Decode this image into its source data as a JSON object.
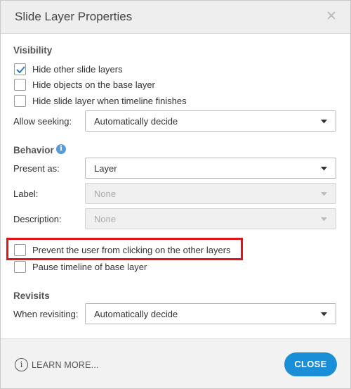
{
  "dialog": {
    "title": "Slide Layer Properties",
    "close_icon": "close-x-icon"
  },
  "visibility": {
    "heading": "Visibility",
    "options": [
      {
        "label": "Hide other slide layers",
        "checked": true
      },
      {
        "label": "Hide objects on the base layer",
        "checked": false
      },
      {
        "label": "Hide slide layer when timeline finishes",
        "checked": false
      }
    ],
    "allow_seeking_label": "Allow seeking:",
    "allow_seeking_value": "Automatically decide"
  },
  "behavior": {
    "heading": "Behavior",
    "info_icon": "info-icon",
    "info_glyph": "i",
    "present_as_label": "Present as:",
    "present_as_value": "Layer",
    "label_label": "Label:",
    "label_value": "None",
    "description_label": "Description:",
    "description_value": "None",
    "options": [
      {
        "label": "Prevent the user from clicking on the other layers",
        "checked": false,
        "highlighted": true
      },
      {
        "label": "Pause timeline of base layer",
        "checked": false
      }
    ]
  },
  "revisits": {
    "heading": "Revisits",
    "when_revisiting_label": "When revisiting:",
    "when_revisiting_value": "Automatically decide"
  },
  "footer": {
    "learn_more_glyph": "i",
    "learn_more_label": "LEARN MORE...",
    "close_label": "CLOSE"
  },
  "colors": {
    "accent": "#1a8fd8",
    "checkmark": "#2a7ac0",
    "highlight_border": "#e0141b"
  }
}
